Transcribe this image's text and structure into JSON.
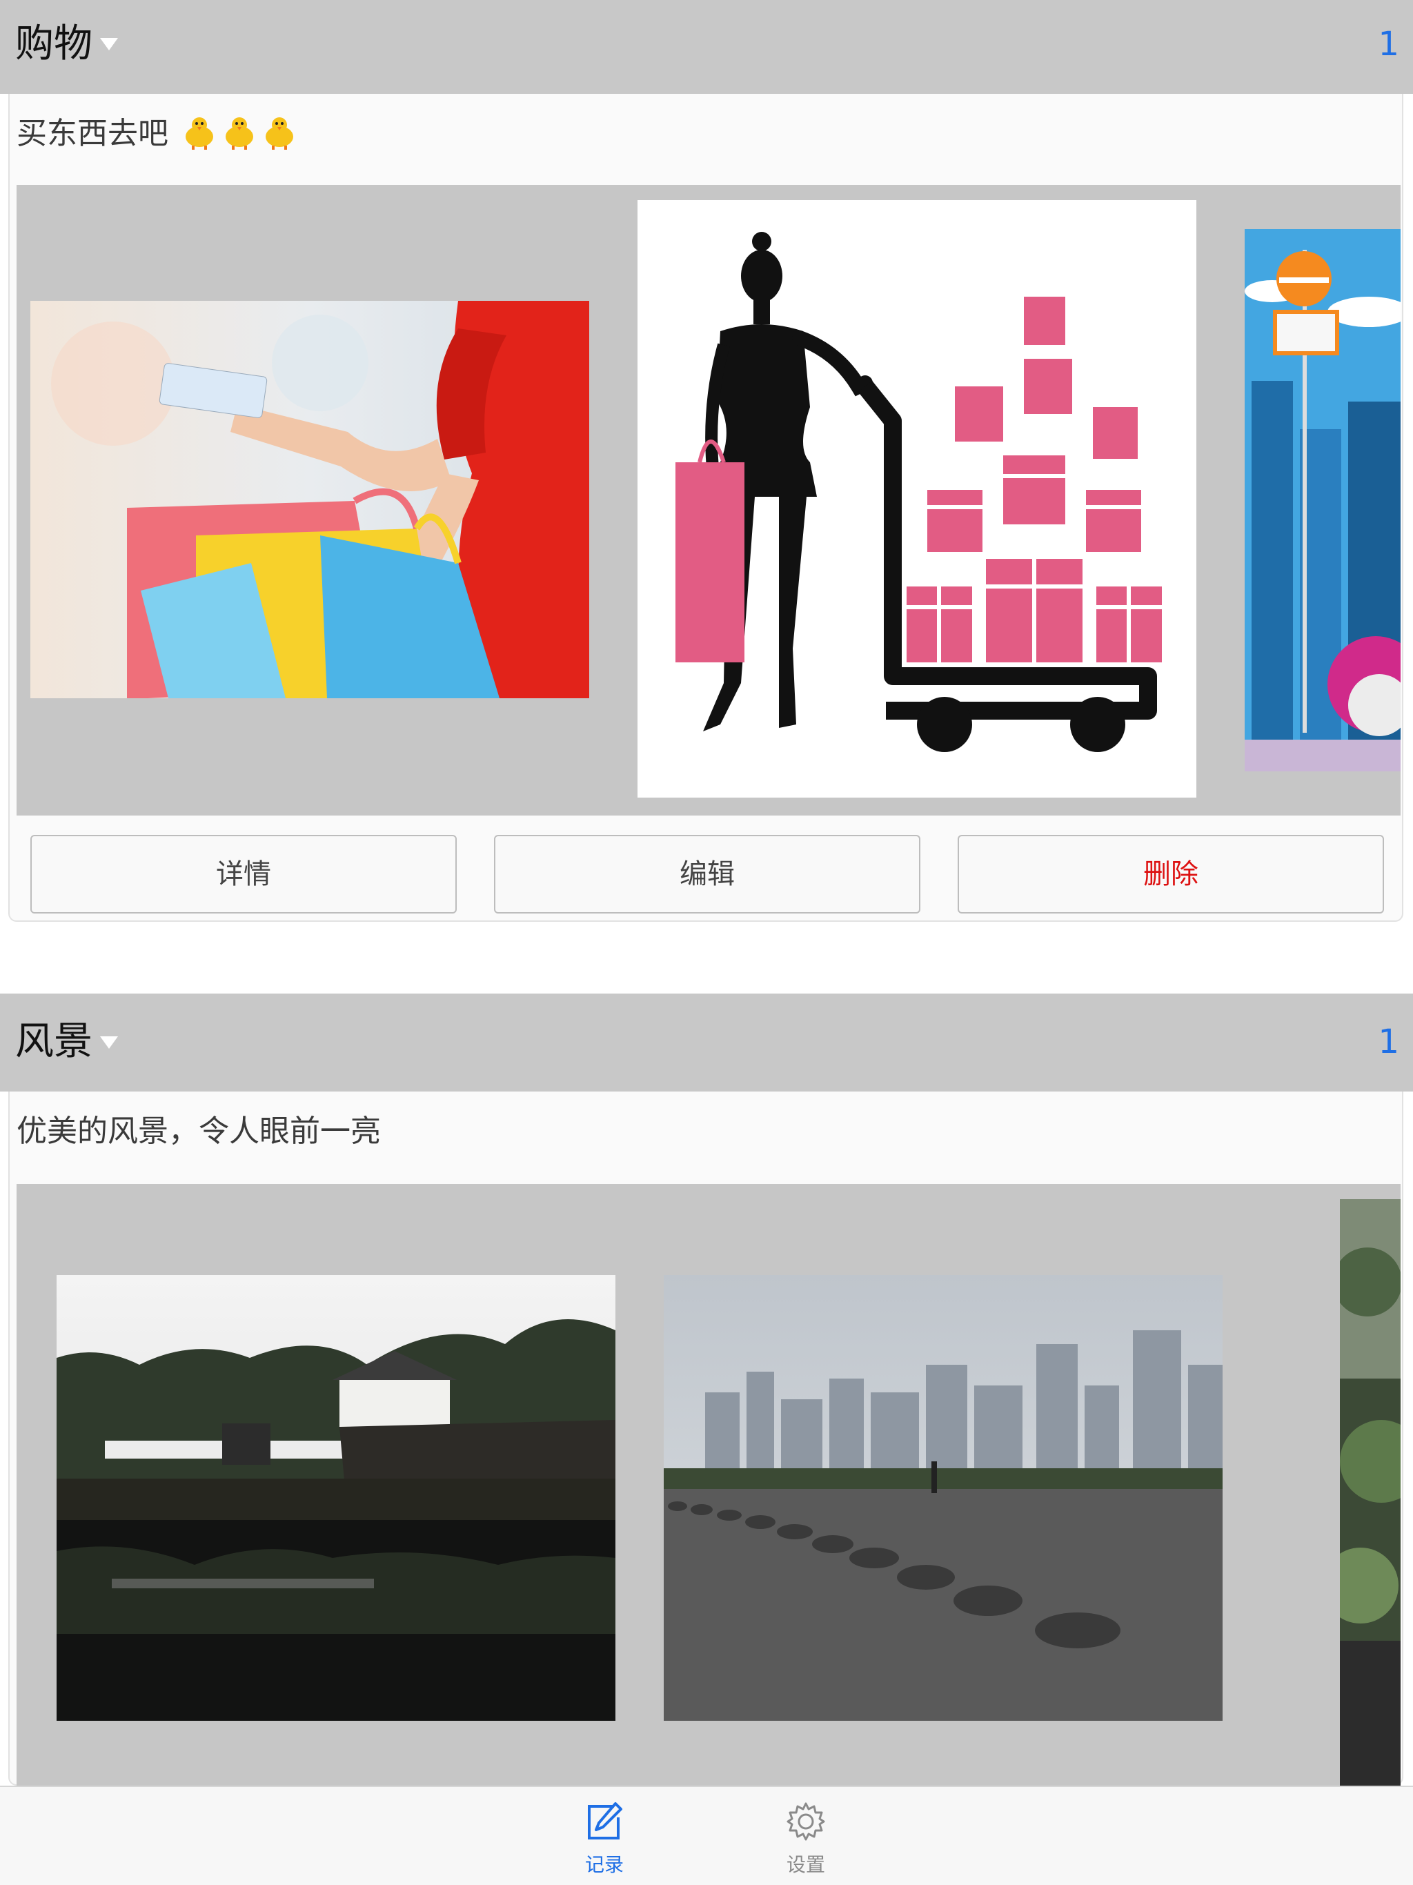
{
  "sections": [
    {
      "title": "购物",
      "count": "1",
      "description": "买东西去吧",
      "description_emoji": "chick-emoji",
      "buttons": {
        "detail": "详情",
        "edit": "编辑",
        "delete": "删除"
      }
    },
    {
      "title": "风景",
      "count": "1",
      "description": "优美的风景，令人眼前一亮"
    }
  ],
  "tabbar": {
    "tabs": [
      {
        "label": "记录",
        "icon": "edit-icon",
        "active": true
      },
      {
        "label": "设置",
        "icon": "gear-icon",
        "active": false
      }
    ]
  },
  "colors": {
    "accent": "#1f6fe5",
    "danger": "#dd1111",
    "header_bg": "#c8c8c8"
  }
}
